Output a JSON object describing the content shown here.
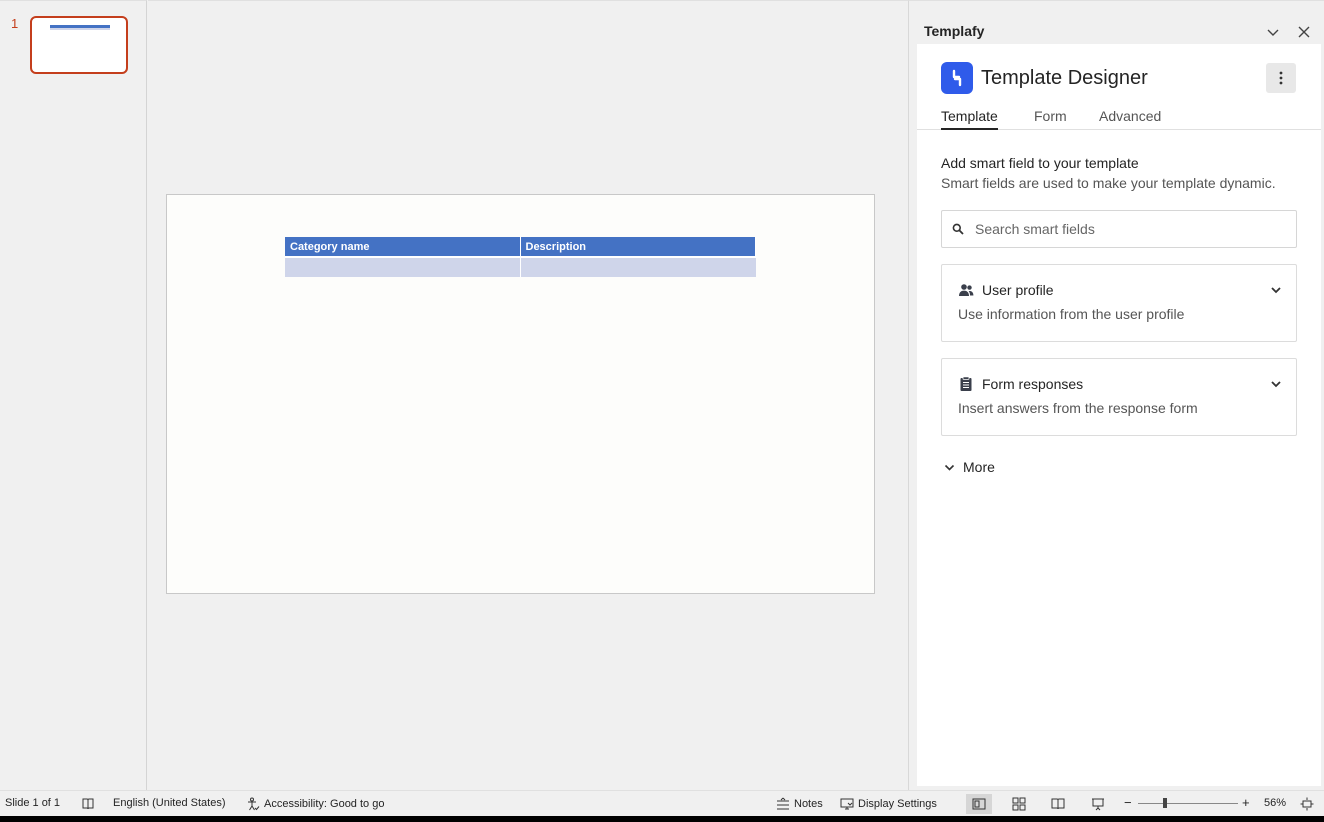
{
  "thumbnails": {
    "slide_number": "1"
  },
  "slide": {
    "table_headers": [
      "Category name",
      "Description"
    ]
  },
  "pane": {
    "title": "Templafy",
    "app_name": "Template Designer",
    "tabs": [
      "Template",
      "Form",
      "Advanced"
    ],
    "active_tab": "Template",
    "section_title": "Add smart field to your template",
    "section_subtitle": "Smart fields are used to make your template dynamic.",
    "search_placeholder": "Search smart fields",
    "cards": [
      {
        "title": "User profile",
        "description": "Use information from the user profile",
        "icon": "users-icon"
      },
      {
        "title": "Form responses",
        "description": "Insert answers from the response form",
        "icon": "clipboard-icon"
      }
    ],
    "more_label": "More",
    "brand_color": "#2f5bea"
  },
  "status": {
    "slide_info": "Slide 1 of 1",
    "language": "English (United States)",
    "accessibility": "Accessibility: Good to go",
    "notes": "Notes",
    "display_settings": "Display Settings",
    "zoom": "56%",
    "zoom_minus": "−",
    "zoom_plus": "+"
  }
}
